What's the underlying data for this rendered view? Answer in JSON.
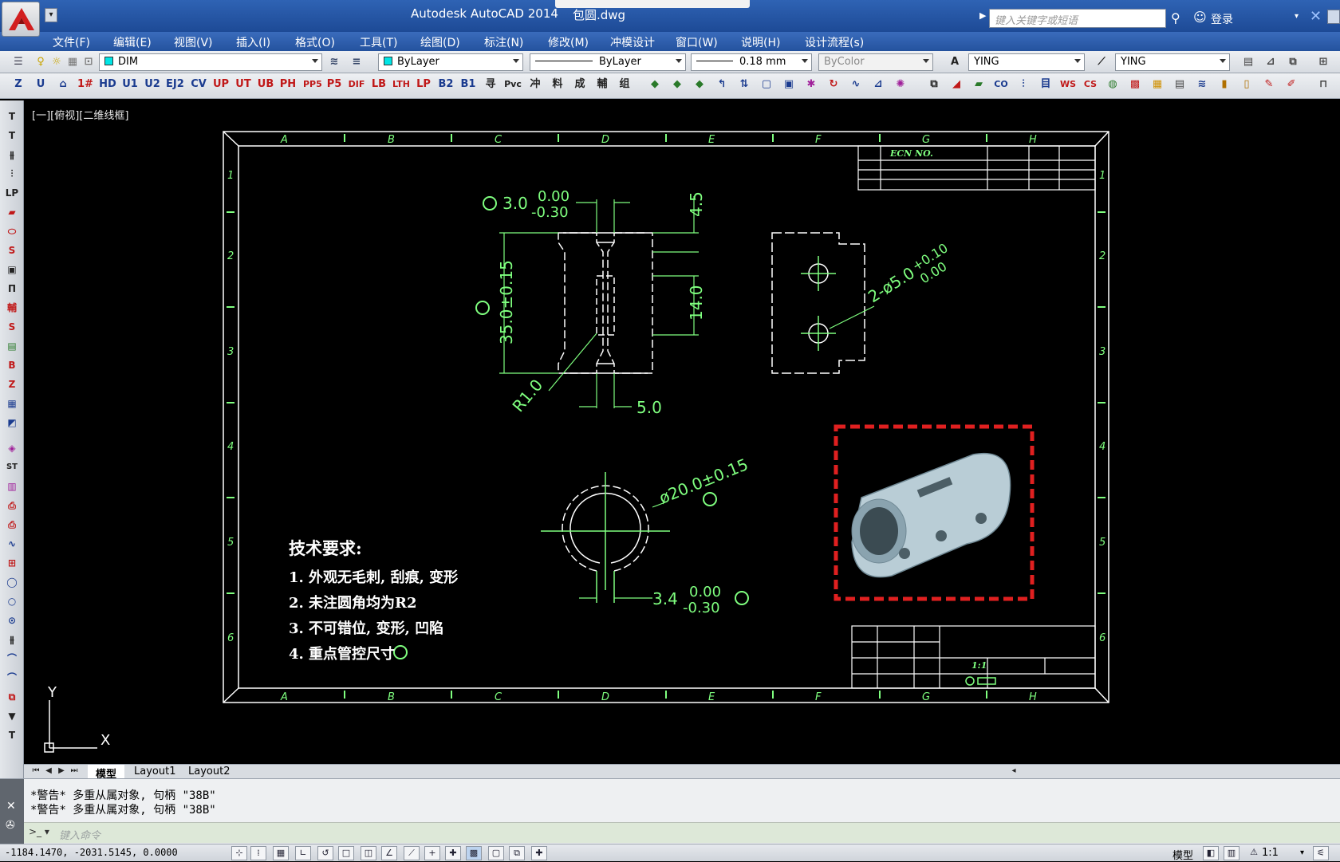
{
  "window": {
    "app_title": "Autodesk AutoCAD 2014",
    "file_name": "包圆.dwg",
    "search_placeholder": "键入关键字或短语",
    "login": "登录"
  },
  "menu": [
    "文件(F)",
    "编辑(E)",
    "视图(V)",
    "插入(I)",
    "格式(O)",
    "工具(T)",
    "绘图(D)",
    "标注(N)",
    "修改(M)",
    "冲模设计",
    "窗口(W)",
    "说明(H)",
    "设计流程(s)"
  ],
  "toolbar1": {
    "layer": "DIM",
    "color": "ByLayer",
    "linetype": "ByLayer",
    "lineweight": "0.18 mm",
    "plotstyle": "ByColor",
    "text_style": "YING",
    "dim_style": "YING"
  },
  "toolbar2_icons": [
    "1#",
    "HD",
    "U1",
    "U2",
    "EJ2",
    "CV",
    "UP",
    "UT",
    "UB",
    "PH",
    "PP5",
    "P5",
    "DIF",
    "LB",
    "LTH",
    "LP",
    "B2",
    "B1",
    "寻",
    "Pvc",
    "冲",
    "料",
    "成",
    "輔",
    "组"
  ],
  "viewport_label": "[一][俯视][二维线框]",
  "drawing": {
    "border_cols": [
      "A",
      "B",
      "C",
      "D",
      "E",
      "F",
      "G",
      "H"
    ],
    "border_rows": [
      "1",
      "2",
      "3",
      "4",
      "5",
      "6"
    ],
    "ecn_header": "ECN NO.",
    "dims": {
      "d_gap_top": "3.0",
      "d_gap_top_tol_up": "0.00",
      "d_gap_top_tol_dn": "-0.30",
      "d_45": "4.5",
      "d_35": "35.0±0.15",
      "d_14": "14.0",
      "d_r1": "R1.0",
      "d_5": "5.0",
      "d_hole": "2-ø5.0",
      "d_hole_tol_up": "+0.10",
      "d_hole_tol_dn": "0.00",
      "d_dia": "ø20.0±0.15",
      "d_gap_bot": "3.4",
      "d_gap_bot_tol_up": "0.00",
      "d_gap_bot_tol_dn": "-0.30"
    },
    "notes_title": "技术要求:",
    "notes": [
      "1. 外观无毛刺, 刮痕, 变形",
      "2. 未注圆角均为R2",
      "3. 不可错位, 变形, 凹陷",
      "4. 重点管控尺寸"
    ],
    "titleblock_scale": "1:1",
    "ucs_x": "X",
    "ucs_y": "Y"
  },
  "tabs": [
    "模型",
    "Layout1",
    "Layout2"
  ],
  "command_history": [
    "*警告* 多重从属对象, 句柄 \"38B\"",
    "*警告* 多重从属对象, 句柄 \"38B\""
  ],
  "command_placeholder": "键入命令",
  "status": {
    "coords": "-1184.1470, -2031.5145, 0.0000",
    "model": "模型",
    "scale": "1:1"
  },
  "colors": {
    "drawing_bg": "#000000",
    "border": "#ffffff",
    "dimension": "#7fff7f",
    "highlight_box": "#e02020"
  }
}
